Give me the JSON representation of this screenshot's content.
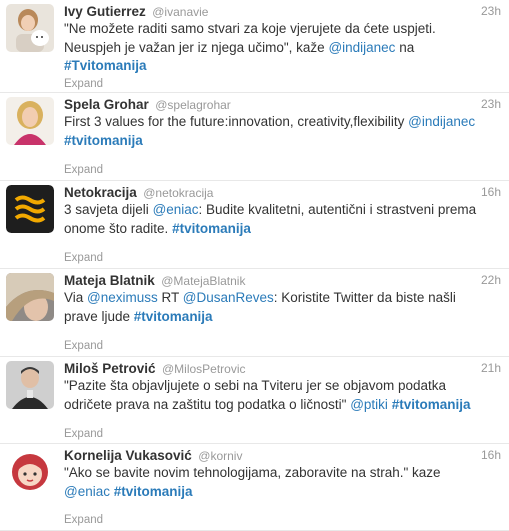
{
  "tweets": [
    {
      "fullname": "Ivy Gutierrez",
      "username": "@ivanavie",
      "time": "23h",
      "lines": [
        [
          {
            "t": "text",
            "v": "\"Ne možete raditi samo stvari za koje vjerujete da ćete uspjeti."
          }
        ],
        [
          {
            "t": "text",
            "v": "Neuspjeh je važan jer iz njega učimo\", kaže "
          },
          {
            "t": "mention",
            "v": "@indijanec"
          },
          {
            "t": "text",
            "v": " na"
          }
        ],
        [
          {
            "t": "hashtag",
            "v": "#Tvitomanija"
          }
        ]
      ],
      "expand": "Expand",
      "avatar": "woman-with-dog"
    },
    {
      "fullname": "Spela Grohar",
      "username": "@spelagrohar",
      "time": "23h",
      "lines": [
        [
          {
            "t": "text",
            "v": "First 3 values for the future:innovation, creativity,flexibility "
          },
          {
            "t": "mention",
            "v": "@indijanec"
          }
        ],
        [
          {
            "t": "hashtag",
            "v": "#tvitomanija"
          }
        ]
      ],
      "expand": "Expand",
      "avatar": "blonde-woman"
    },
    {
      "fullname": "Netokracija",
      "username": "@netokracija",
      "time": "16h",
      "lines": [
        [
          {
            "t": "text",
            "v": "3 savjeta dijeli "
          },
          {
            "t": "mention",
            "v": "@eniac"
          },
          {
            "t": "text",
            "v": ": Budite kvalitetni, autentični i strastveni prema"
          }
        ],
        [
          {
            "t": "text",
            "v": "onome što radite. "
          },
          {
            "t": "hashtag",
            "v": "#tvitomanija"
          }
        ]
      ],
      "expand": "Expand",
      "avatar": "wave-logo"
    },
    {
      "fullname": "Mateja Blatnik",
      "username": "@MatejaBlatnik",
      "time": "22h",
      "lines": [
        [
          {
            "t": "text",
            "v": "Via "
          },
          {
            "t": "mention",
            "v": "@neximuss"
          },
          {
            "t": "text",
            "v": " RT "
          },
          {
            "t": "mention",
            "v": "@DusanReves"
          },
          {
            "t": "text",
            "v": ": Koristite Twitter da biste našli"
          }
        ],
        [
          {
            "t": "text",
            "v": "prave ljude "
          },
          {
            "t": "hashtag",
            "v": "#tvitomanija"
          }
        ]
      ],
      "expand": "Expand",
      "avatar": "woman-hair"
    },
    {
      "fullname": "Miloš Petrović",
      "username": "@MilosPetrovic",
      "time": "21h",
      "lines": [
        [
          {
            "t": "text",
            "v": "\"Pazite šta objavljujete o sebi na Tviteru jer se objavom podatka"
          }
        ],
        [
          {
            "t": "text",
            "v": "odričete prava na zaštitu tog podatka o ličnosti\" "
          },
          {
            "t": "mention",
            "v": "@ptiki"
          },
          {
            "t": "text",
            "v": " "
          },
          {
            "t": "hashtag",
            "v": "#tvitomanija"
          }
        ]
      ],
      "expand": "Expand",
      "avatar": "man-portrait"
    },
    {
      "fullname": "Kornelija Vukasović",
      "username": "@korniv",
      "time": "16h",
      "lines": [
        [
          {
            "t": "text",
            "v": "\"Ako se bavite novim tehnologijama, zaboravite na strah.\" kaze"
          }
        ],
        [
          {
            "t": "mention",
            "v": "@eniac"
          },
          {
            "t": "text",
            "v": " "
          },
          {
            "t": "hashtag",
            "v": "#tvitomanija"
          }
        ]
      ],
      "expand": "Expand",
      "avatar": "cartoon-girl"
    }
  ]
}
